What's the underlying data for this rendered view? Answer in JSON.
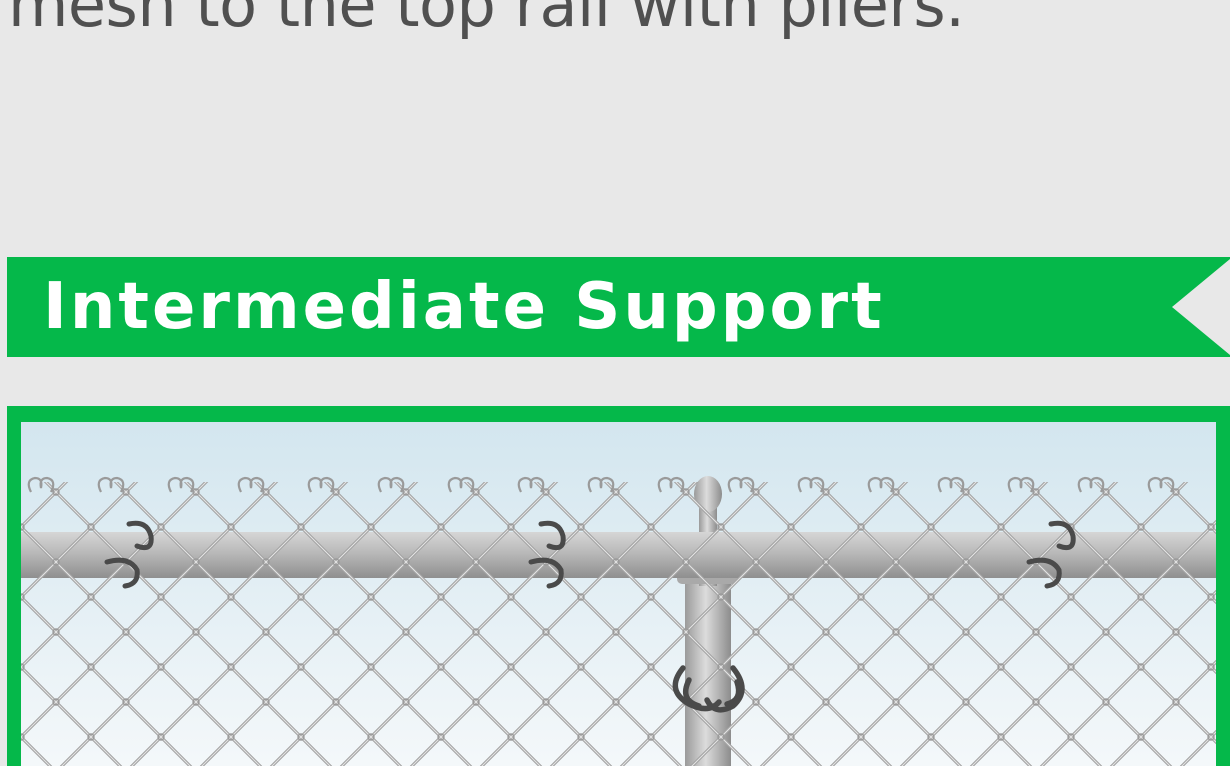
{
  "step_text": "mesh to the top rail with pliers.",
  "section": {
    "title": "Intermediate Support"
  },
  "illustration": {
    "subject": "chain-link-fence-intermediate-support"
  },
  "colors": {
    "background": "#e8e8e8",
    "accent": "#05b84a",
    "body_text": "#505050",
    "title_text": "#ffffff",
    "sky_top": "#d3e6ef",
    "sky_bottom": "#f4f8fa",
    "rail": "#b8b8b8",
    "mesh": "#9e9e9e",
    "tie": "#4a4a4a"
  }
}
